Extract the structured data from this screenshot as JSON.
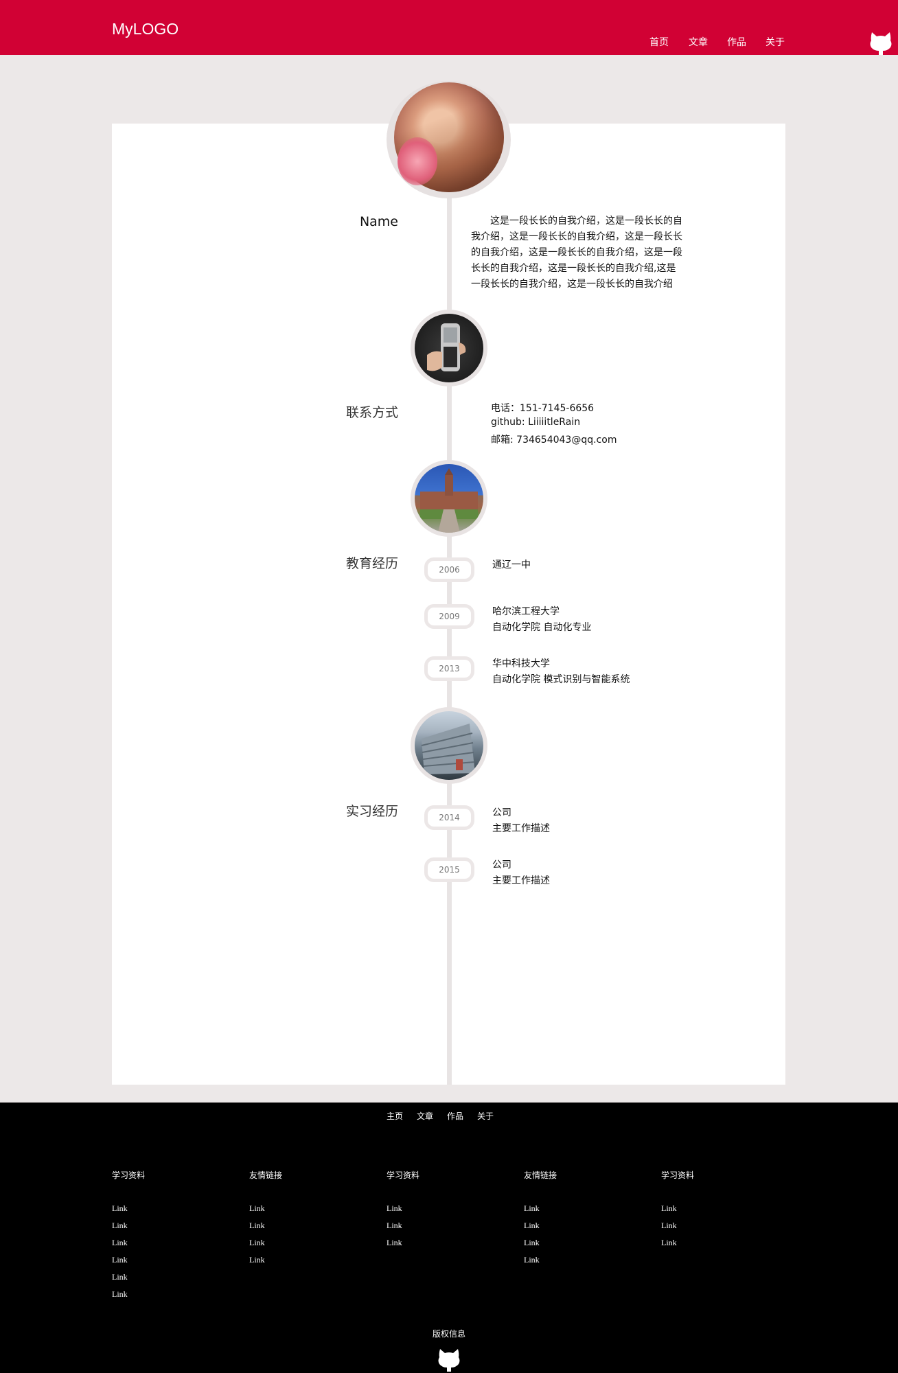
{
  "header": {
    "logo": "MyLOGO",
    "nav": [
      "首页",
      "文章",
      "作品",
      "关于"
    ],
    "github_icon": "github-octocat-icon",
    "color": "#d10134"
  },
  "profile": {
    "name": "Name",
    "intro": "这是一段长长的自我介绍，这是一段长长的自我介绍，这是一段长长的自我介绍，这是一段长长的自我介绍，这是一段长长的自我介绍，这是一段长长的自我介绍，这是一段长长的自我介绍,这是一段长长的自我介绍，这是一段长长的自我介绍"
  },
  "contact": {
    "title": "联系方式",
    "phone": "电话：151-7145-6656",
    "github": "github: LiiiiitleRain",
    "email": "邮箱: 734654043@qq.com"
  },
  "education": {
    "title": "教育经历",
    "entries": [
      {
        "year": "2006",
        "line1": "通辽一中",
        "line2": ""
      },
      {
        "year": "2009",
        "line1": "哈尔滨工程大学",
        "line2": "自动化学院 自动化专业"
      },
      {
        "year": "2013",
        "line1": "华中科技大学",
        "line2": "自动化学院 模式识别与智能系统"
      }
    ]
  },
  "internship": {
    "title": "实习经历",
    "entries": [
      {
        "year": "2014",
        "line1": "公司",
        "line2": "主要工作描述"
      },
      {
        "year": "2015",
        "line1": "公司",
        "line2": "主要工作描述"
      }
    ]
  },
  "footer": {
    "nav": [
      "主页",
      "文章",
      "作品",
      "关于"
    ],
    "columns": [
      {
        "title": "学习资料",
        "links": [
          "Link",
          "Link",
          "Link",
          "Link",
          "Link",
          "Link"
        ]
      },
      {
        "title": "友情链接",
        "links": [
          "Link",
          "Link",
          "Link",
          "Link"
        ]
      },
      {
        "title": "学习资料",
        "links": [
          "Link",
          "Link",
          "Link"
        ]
      },
      {
        "title": "友情链接",
        "links": [
          "Link",
          "Link",
          "Link",
          "Link"
        ]
      },
      {
        "title": "学习资料",
        "links": [
          "Link",
          "Link",
          "Link"
        ]
      }
    ],
    "copyright": "版权信息"
  }
}
